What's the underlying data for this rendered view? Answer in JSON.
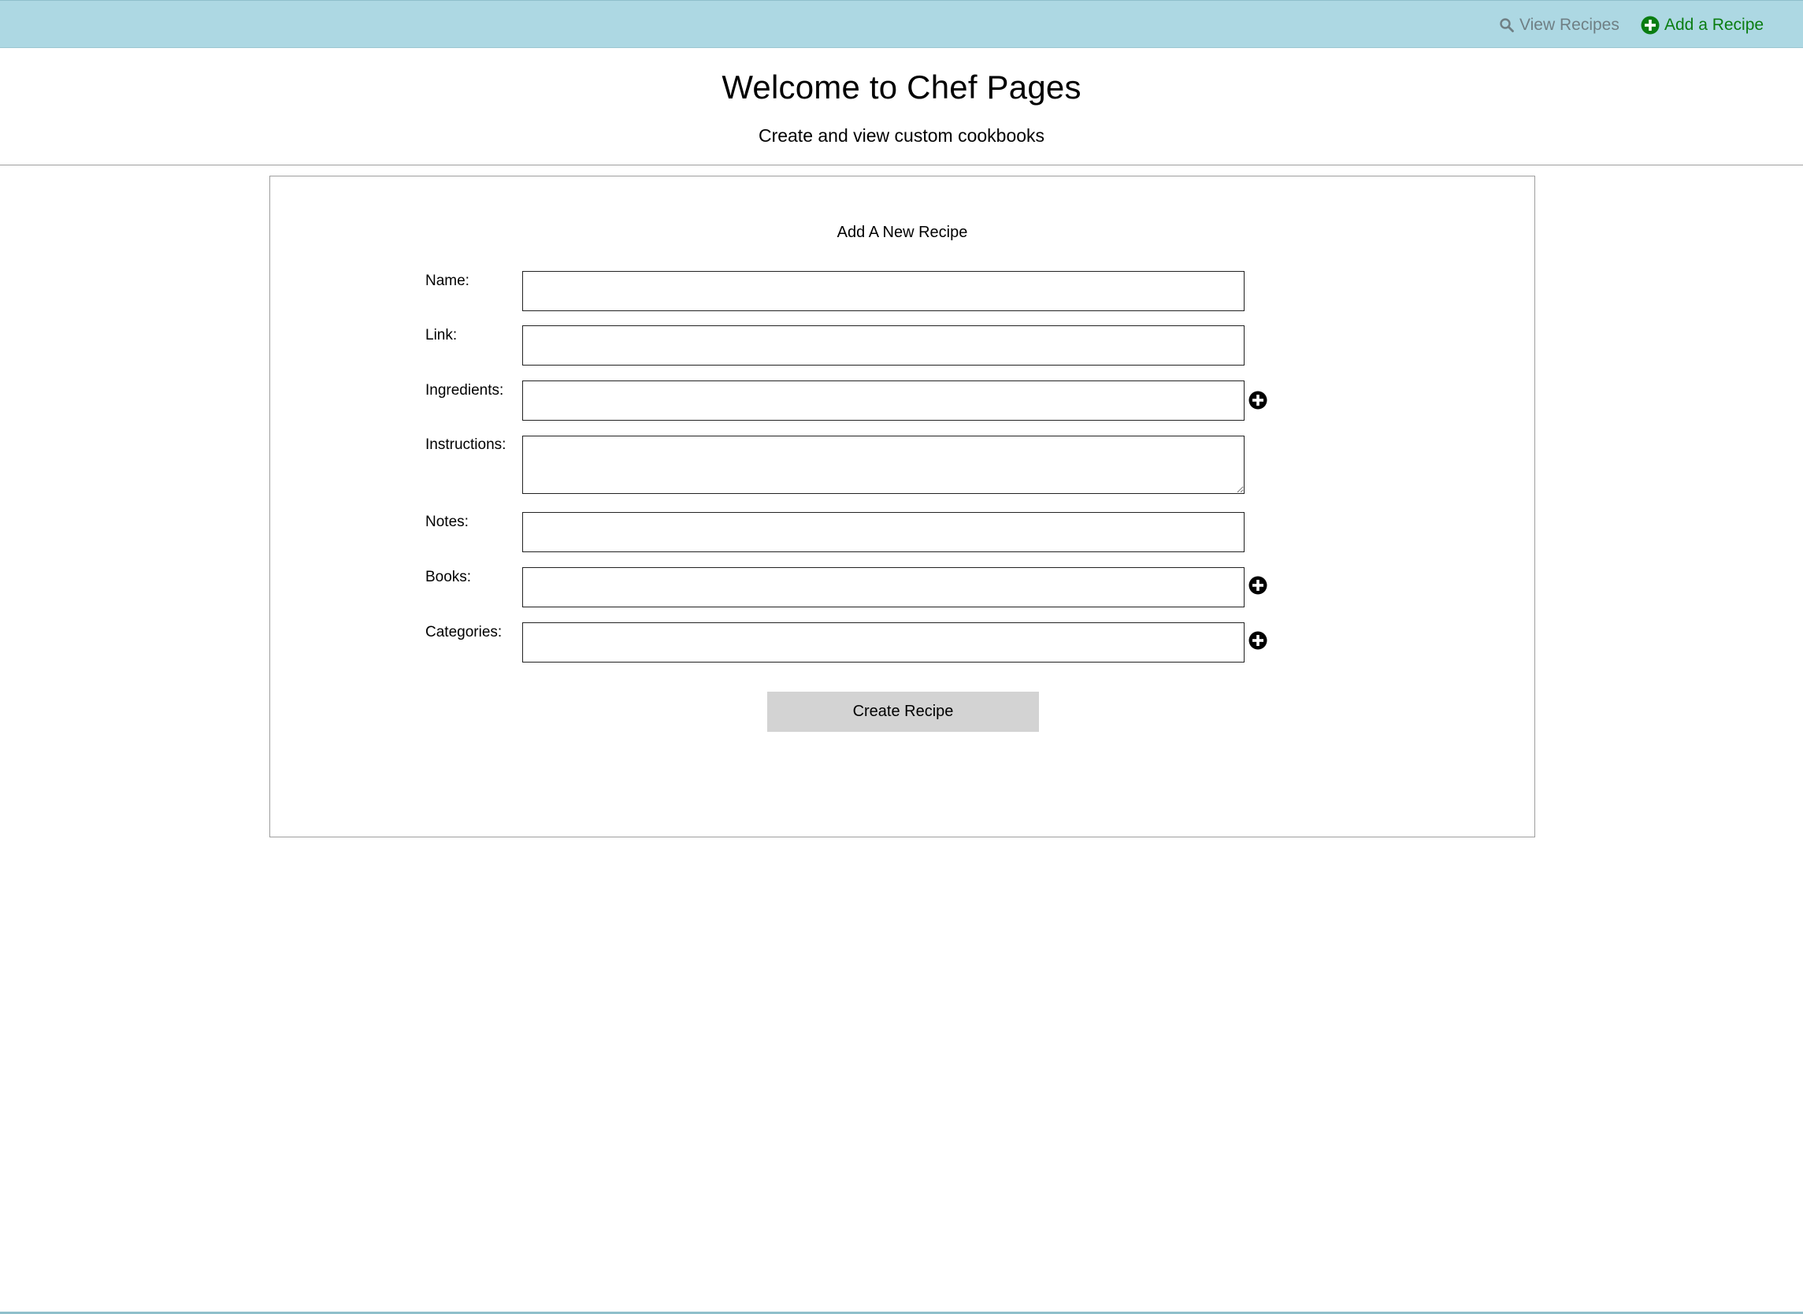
{
  "nav": {
    "view_label": "View Recipes",
    "view_icon": "search-icon",
    "add_label": "Add a Recipe",
    "add_icon": "plus-circle-icon",
    "view_color": "#6f7f84",
    "add_color": "#0a7d12",
    "bar_color": "#add8e3"
  },
  "header": {
    "title": "Welcome to Chef Pages",
    "subtitle": "Create and view custom cookbooks"
  },
  "form": {
    "title": "Add A New Recipe",
    "fields": {
      "name": {
        "label": "Name:",
        "value": ""
      },
      "link": {
        "label": "Link:",
        "value": ""
      },
      "ingredients": {
        "label": "Ingredients:",
        "value": ""
      },
      "instructions": {
        "label": "Instructions:",
        "value": ""
      },
      "notes": {
        "label": "Notes:",
        "value": ""
      },
      "books": {
        "label": "Books:",
        "value": ""
      },
      "categories": {
        "label": "Categories:",
        "value": ""
      }
    },
    "submit_label": "Create Recipe",
    "submit_color": "#d3d3d3"
  }
}
